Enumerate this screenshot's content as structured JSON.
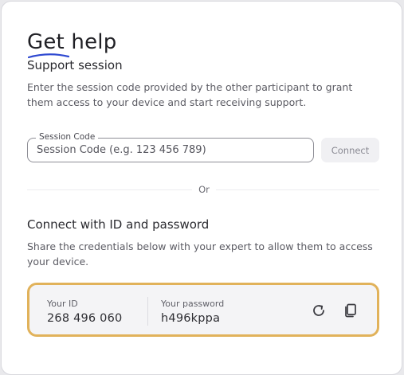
{
  "header": {
    "title": "Get help",
    "subtitle": "Support session"
  },
  "session": {
    "description": "Enter the session code provided by the other participant to grant them access to your device and start receiving support.",
    "field_label": "Session Code",
    "placeholder": "Session Code (e.g. 123 456 789)",
    "value": "",
    "connect_label": "Connect"
  },
  "divider": {
    "label": "Or"
  },
  "credentials": {
    "title": "Connect with ID and password",
    "description": "Share the credentials below with your expert to allow them to access your device.",
    "id_label": "Your ID",
    "id_value": "268 496 060",
    "password_label": "Your password",
    "password_value": "h496kppa",
    "refresh_icon": "refresh-icon",
    "copy_icon": "copy-icon"
  },
  "colors": {
    "accent_underline": "#2f49d1",
    "highlight_border": "#e1b25a",
    "box_background": "#f4f4f6"
  }
}
